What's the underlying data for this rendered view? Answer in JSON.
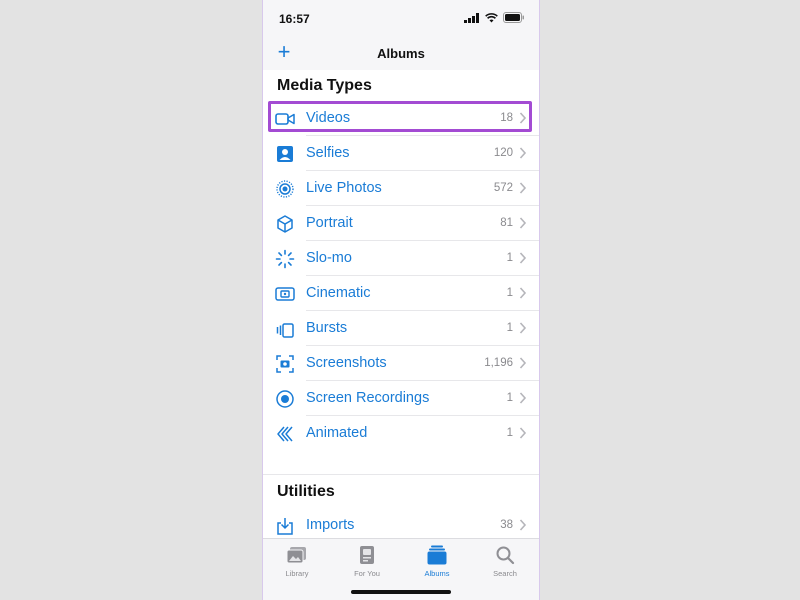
{
  "status": {
    "time": "16:57"
  },
  "nav": {
    "title": "Albums",
    "add_symbol": "+"
  },
  "sections": [
    {
      "title": "Media Types"
    },
    {
      "title": "Utilities"
    }
  ],
  "media_types": [
    {
      "label": "Videos",
      "count": "18",
      "icon": "video-camera-icon"
    },
    {
      "label": "Selfies",
      "count": "120",
      "icon": "selfie-portrait-icon"
    },
    {
      "label": "Live Photos",
      "count": "572",
      "icon": "live-photo-icon"
    },
    {
      "label": "Portrait",
      "count": "81",
      "icon": "cube-icon"
    },
    {
      "label": "Slo-mo",
      "count": "1",
      "icon": "slomo-dial-icon"
    },
    {
      "label": "Cinematic",
      "count": "1",
      "icon": "cinematic-icon"
    },
    {
      "label": "Bursts",
      "count": "1",
      "icon": "bursts-icon"
    },
    {
      "label": "Screenshots",
      "count": "1,196",
      "icon": "screenshot-icon"
    },
    {
      "label": "Screen Recordings",
      "count": "1",
      "icon": "screen-recording-icon"
    },
    {
      "label": "Animated",
      "count": "1",
      "icon": "animated-icon"
    }
  ],
  "utilities": [
    {
      "label": "Imports",
      "count": "38",
      "icon": "import-tray-icon"
    }
  ],
  "tabs": [
    {
      "label": "Library",
      "icon": "photo-library-icon",
      "active": false
    },
    {
      "label": "For You",
      "icon": "for-you-icon",
      "active": false
    },
    {
      "label": "Albums",
      "icon": "albums-stack-icon",
      "active": true
    },
    {
      "label": "Search",
      "icon": "magnifier-icon",
      "active": false
    }
  ],
  "colors": {
    "accent": "#1a7cd6",
    "highlight": "#a34bd3",
    "secondary_text": "#8a8a8e"
  }
}
